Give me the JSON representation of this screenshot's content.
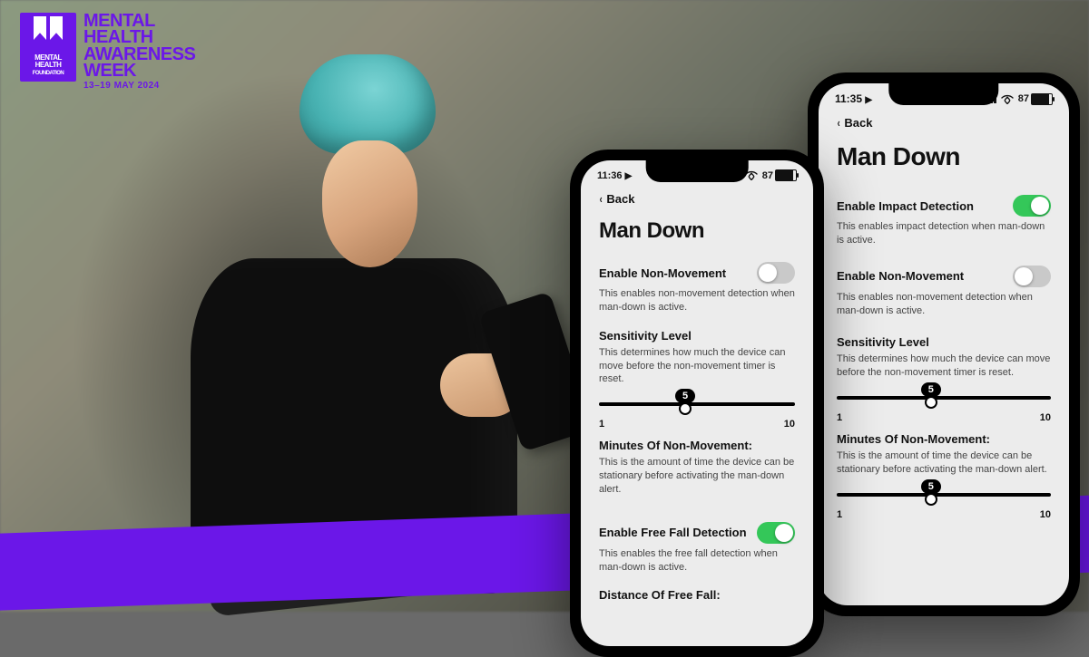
{
  "badge": {
    "ribbon_top": "MENTAL",
    "ribbon_bottom": "HEALTH",
    "ribbon_caption": "FOUNDATION",
    "line1": "MENTAL",
    "line2": "HEALTH",
    "line3": "AWARENESS",
    "line4": "WEEK",
    "dates": "13–19 MAY 2024"
  },
  "phone_left": {
    "status": {
      "time": "11:36",
      "cell": "4",
      "battery_pct": "87"
    },
    "back_label": "Back",
    "title": "Man Down",
    "enable_nonmove": {
      "label": "Enable Non-Movement",
      "desc": "This enables non-movement detection when man-down is active.",
      "on": false
    },
    "sensitivity": {
      "label": "Sensitivity Level",
      "desc": "This determines how much the device can move before the non-movement timer is reset.",
      "value": 5,
      "min": 1,
      "max": 10
    },
    "minutes": {
      "label": "Minutes Of Non-Movement:",
      "desc": "This is the amount of time the device can be stationary before activating the man-down alert."
    },
    "freefall": {
      "label": "Enable Free Fall Detection",
      "desc": "This enables the free fall detection when man-down is active.",
      "on": true
    },
    "freefall_distance_label": "Distance Of Free Fall:"
  },
  "phone_right": {
    "status": {
      "time": "11:35",
      "cell": "4",
      "battery_pct": "87"
    },
    "back_label": "Back",
    "title": "Man Down",
    "impact": {
      "label": "Enable Impact Detection",
      "desc": "This enables impact detection when man-down is active.",
      "on": true
    },
    "enable_nonmove": {
      "label": "Enable Non-Movement",
      "desc": "This enables non-movement detection when man-down is active.",
      "on": false
    },
    "sensitivity": {
      "label": "Sensitivity Level",
      "desc": "This determines how much the device can move before the non-movement timer is reset.",
      "value": 5,
      "min": 1,
      "max": 10
    },
    "minutes": {
      "label": "Minutes Of Non-Movement:",
      "desc": "This is the amount of time the device can be stationary before activating the man-down alert.",
      "value": 5,
      "min": 1,
      "max": 10
    }
  }
}
